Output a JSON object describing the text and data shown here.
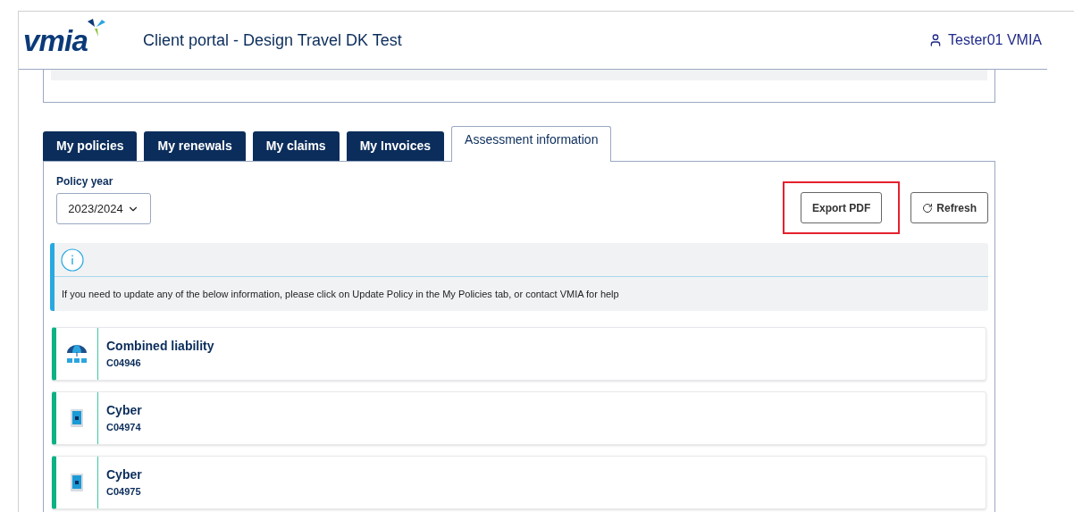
{
  "header": {
    "logo": "vmia",
    "title": "Client portal - Design Travel DK Test",
    "user": "Tester01 VMIA"
  },
  "tabs": [
    {
      "label": "My policies",
      "selected": false
    },
    {
      "label": "My renewals",
      "selected": false
    },
    {
      "label": "My claims",
      "selected": false
    },
    {
      "label": "My Invoices",
      "selected": false
    },
    {
      "label": "Assessment information",
      "selected": true
    }
  ],
  "policy_year": {
    "label": "Policy year",
    "value": "2023/2024"
  },
  "buttons": [
    {
      "label": "Export PDF",
      "kind": "export",
      "highlighted": true
    },
    {
      "label": "Refresh",
      "kind": "refresh",
      "highlighted": false
    }
  ],
  "info": {
    "text": "If you need to update any of the below information, please click on Update Policy in the My Policies tab, or contact VMIA for help"
  },
  "policies": [
    {
      "name": "Combined liability",
      "code": "C04946",
      "kind": "umbrella"
    },
    {
      "name": "Cyber",
      "code": "C04974",
      "kind": "device"
    },
    {
      "name": "Cyber",
      "code": "C04975",
      "kind": "device"
    }
  ]
}
